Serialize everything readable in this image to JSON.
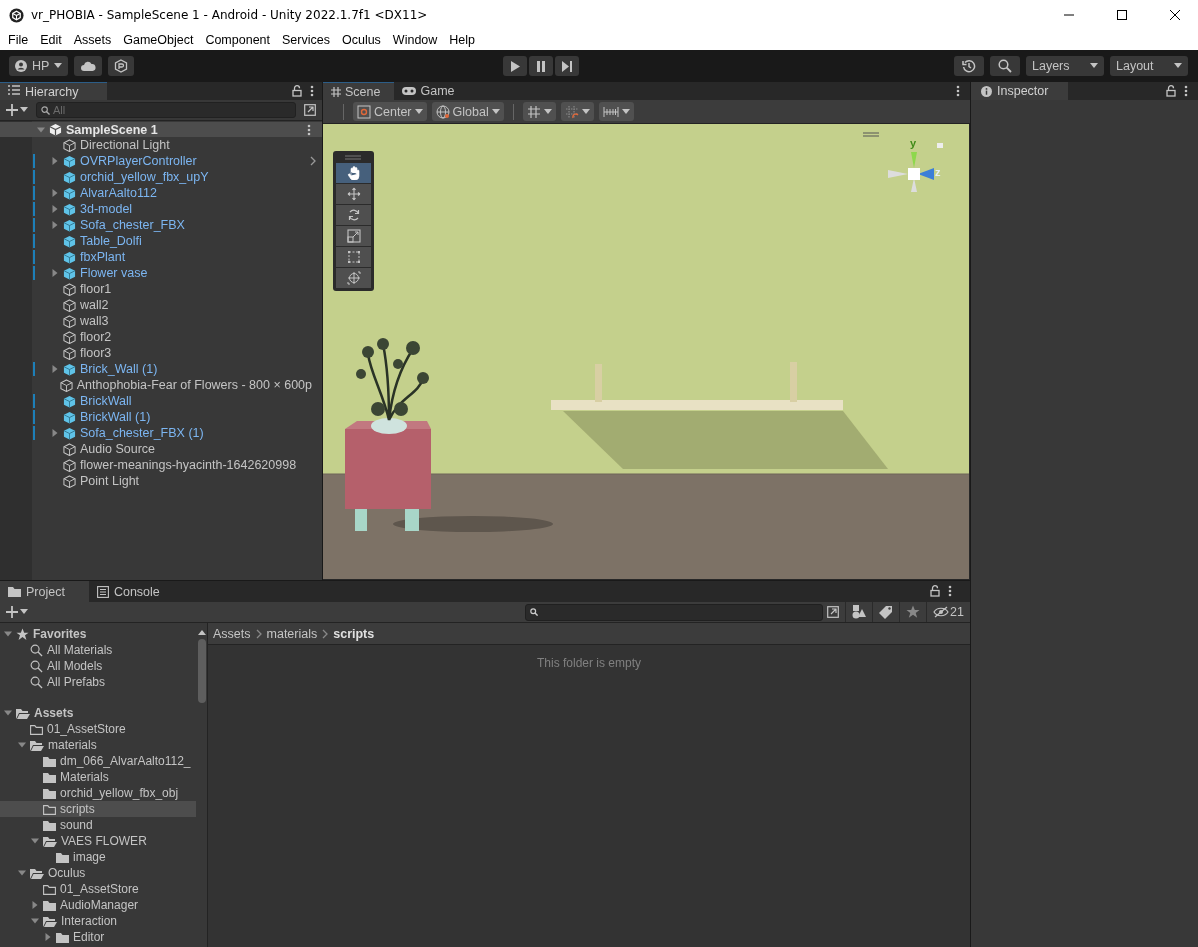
{
  "window": {
    "title": "vr_PHOBIA - SampleScene 1 - Android - Unity 2022.1.7f1 <DX11>"
  },
  "menu": [
    "File",
    "Edit",
    "Assets",
    "GameObject",
    "Component",
    "Services",
    "Oculus",
    "Window",
    "Help"
  ],
  "toolbar": {
    "account": "HP",
    "layers": "Layers",
    "layout": "Layout"
  },
  "hierarchy": {
    "tab": "Hierarchy",
    "search_placeholder": "All",
    "scene": {
      "name": "SampleScene 1",
      "expanded": true
    },
    "items": [
      {
        "name": "Directional Light",
        "kind": "object",
        "expandable": false,
        "overrides": false
      },
      {
        "name": "OVRPlayerController",
        "kind": "prefab",
        "expandable": true,
        "overrides": true
      },
      {
        "name": "orchid_yellow_fbx_upY",
        "kind": "prefab",
        "expandable": false,
        "overrides": false
      },
      {
        "name": "AlvarAalto112",
        "kind": "prefab",
        "expandable": true,
        "overrides": false
      },
      {
        "name": "3d-model",
        "kind": "prefab",
        "expandable": true,
        "overrides": false
      },
      {
        "name": "Sofa_chester_FBX",
        "kind": "prefab",
        "expandable": true,
        "overrides": false
      },
      {
        "name": "Table_Dolfi",
        "kind": "prefab",
        "expandable": false,
        "overrides": false
      },
      {
        "name": "fbxPlant",
        "kind": "prefab",
        "expandable": false,
        "overrides": false
      },
      {
        "name": "Flower vase",
        "kind": "prefab",
        "expandable": true,
        "overrides": false
      },
      {
        "name": "floor1",
        "kind": "object",
        "expandable": false,
        "overrides": false
      },
      {
        "name": "wall2",
        "kind": "object",
        "expandable": false,
        "overrides": false
      },
      {
        "name": "wall3",
        "kind": "object",
        "expandable": false,
        "overrides": false
      },
      {
        "name": "floor2",
        "kind": "object",
        "expandable": false,
        "overrides": false
      },
      {
        "name": "floor3",
        "kind": "object",
        "expandable": false,
        "overrides": false
      },
      {
        "name": "Brick_Wall (1)",
        "kind": "prefab",
        "expandable": true,
        "overrides": false
      },
      {
        "name": "Anthophobia-Fear of Flowers - 800 × 600p",
        "kind": "object",
        "expandable": false,
        "overrides": false
      },
      {
        "name": "BrickWall",
        "kind": "prefab",
        "expandable": false,
        "overrides": false
      },
      {
        "name": "BrickWall (1)",
        "kind": "prefab",
        "expandable": false,
        "overrides": false
      },
      {
        "name": "Sofa_chester_FBX (1)",
        "kind": "prefab",
        "expandable": true,
        "overrides": false
      },
      {
        "name": "Audio Source",
        "kind": "object",
        "expandable": false,
        "overrides": false
      },
      {
        "name": "flower-meanings-hyacinth-1642620998",
        "kind": "object",
        "expandable": false,
        "overrides": false
      },
      {
        "name": "Point Light",
        "kind": "object",
        "expandable": false,
        "overrides": false
      }
    ]
  },
  "scene_view": {
    "tabs": [
      {
        "label": "Scene",
        "kind": "scene",
        "selected": true
      },
      {
        "label": "Game",
        "kind": "game",
        "selected": false
      }
    ],
    "pivot": "Center",
    "space": "Global",
    "tools": [
      {
        "kind": "hand",
        "selected": true
      },
      {
        "kind": "move",
        "selected": false
      },
      {
        "kind": "rotate",
        "selected": false
      },
      {
        "kind": "scale",
        "selected": false
      },
      {
        "kind": "rect",
        "selected": false
      },
      {
        "kind": "transform",
        "selected": false
      }
    ],
    "gizmo": {
      "y": "y",
      "z": "z"
    }
  },
  "inspector": {
    "tab": "Inspector"
  },
  "project": {
    "tabs": [
      {
        "label": "Project",
        "kind": "project",
        "selected": true
      },
      {
        "label": "Console",
        "kind": "console",
        "selected": false
      }
    ],
    "hidden_count": "21",
    "tree": [
      {
        "name": "Favorites",
        "kind": "favorites",
        "expanded": true,
        "selected": false,
        "children": [
          {
            "name": "All Materials",
            "kind": "search",
            "selected": false
          },
          {
            "name": "All Models",
            "kind": "search",
            "selected": false
          },
          {
            "name": "All Prefabs",
            "kind": "search",
            "selected": false
          }
        ]
      },
      {
        "name": "Assets",
        "kind": "folder",
        "expanded": true,
        "selected": false,
        "children": [
          {
            "name": "01_AssetStore",
            "kind": "empty-folder",
            "selected": false
          },
          {
            "name": "materials",
            "kind": "folder",
            "expanded": true,
            "selected": false,
            "children": [
              {
                "name": "dm_066_AlvarAalto112_",
                "kind": "folder",
                "selected": false
              },
              {
                "name": "Materials",
                "kind": "folder",
                "selected": false
              },
              {
                "name": "orchid_yellow_fbx_obj",
                "kind": "folder",
                "selected": false
              },
              {
                "name": "scripts",
                "kind": "empty-folder",
                "selected": true
              },
              {
                "name": "sound",
                "kind": "folder",
                "selected": false
              },
              {
                "name": "VAES FLOWER",
                "kind": "folder",
                "expanded": true,
                "selected": false,
                "children": [
                  {
                    "name": "image",
                    "kind": "folder",
                    "selected": false
                  }
                ]
              }
            ]
          },
          {
            "name": "Oculus",
            "kind": "folder",
            "expanded": true,
            "selected": false,
            "children": [
              {
                "name": "01_AssetStore",
                "kind": "empty-folder",
                "selected": false
              },
              {
                "name": "AudioManager",
                "kind": "folder",
                "expanded": false,
                "selected": false
              },
              {
                "name": "Interaction",
                "kind": "folder",
                "expanded": true,
                "selected": false,
                "children": [
                  {
                    "name": "Editor",
                    "kind": "folder",
                    "expanded": false,
                    "selected": false
                  }
                ]
              }
            ]
          }
        ]
      }
    ],
    "breadcrumb": [
      "Assets",
      "materials",
      "scripts"
    ],
    "empty_message": "This folder is empty"
  }
}
